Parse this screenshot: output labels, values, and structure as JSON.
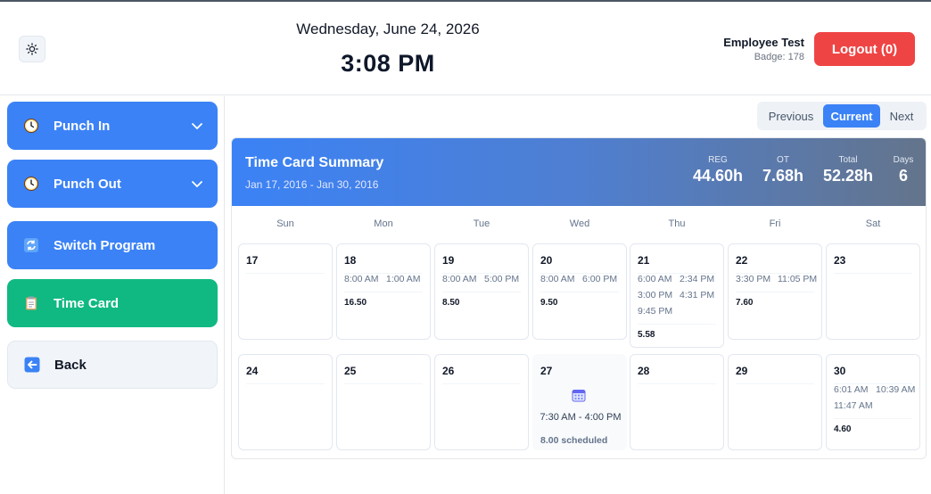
{
  "header": {
    "date": "Wednesday, June 24, 2026",
    "time": "3:08 PM",
    "theme_icon": "sun-icon",
    "employee_name": "Employee Test",
    "badge": "Badge: 178",
    "logout_label": "Logout (0)"
  },
  "sidebar": {
    "items": [
      {
        "label": "Punch In",
        "icon": "clock-icon",
        "color": "#3b82f6"
      },
      {
        "label": "Punch Out",
        "icon": "clock-icon",
        "color": "#3b82f6"
      },
      {
        "label": "Switch Program",
        "icon": "refresh-icon",
        "color": "#3b82f6"
      },
      {
        "label": "Time Card",
        "icon": "clipboard-icon",
        "color": "#10b981"
      },
      {
        "label": "Back",
        "icon": "arrow-left-icon",
        "color": "#f1f5f9"
      }
    ]
  },
  "nav": {
    "previous": "Previous",
    "current": "Current",
    "next": "Next"
  },
  "summary": {
    "title": "Time Card Summary",
    "range": "Jan 17, 2016 - Jan 30, 2016",
    "stats": [
      {
        "label": "REG",
        "value": "44.60h"
      },
      {
        "label": "OT",
        "value": "7.68h"
      },
      {
        "label": "Total",
        "value": "52.28h"
      },
      {
        "label": "Days",
        "value": "6"
      }
    ]
  },
  "calendar": {
    "weekdays": [
      "Sun",
      "Mon",
      "Tue",
      "Wed",
      "Thu",
      "Fri",
      "Sat"
    ],
    "week1": [
      {
        "day": "17",
        "punches": [],
        "hours": ""
      },
      {
        "day": "18",
        "punches": [
          "8:00 AM",
          "1:00 AM"
        ],
        "hours": "16.50"
      },
      {
        "day": "19",
        "punches": [
          "8:00 AM",
          "5:00 PM"
        ],
        "hours": "8.50"
      },
      {
        "day": "20",
        "punches": [
          "8:00 AM",
          "6:00 PM"
        ],
        "hours": "9.50"
      },
      {
        "day": "21",
        "punches": [
          "6:00 AM",
          "2:34 PM",
          "3:00 PM",
          "4:31 PM",
          "9:45 PM"
        ],
        "hours": "5.58"
      },
      {
        "day": "22",
        "punches": [
          "3:30 PM",
          "11:05 PM"
        ],
        "hours": "7.60"
      },
      {
        "day": "23",
        "punches": [],
        "hours": ""
      }
    ],
    "week2": [
      {
        "day": "24",
        "punches": [],
        "hours": ""
      },
      {
        "day": "25",
        "punches": [],
        "hours": ""
      },
      {
        "day": "26",
        "punches": [],
        "hours": ""
      },
      {
        "day": "27",
        "scheduled_time": "7:30 AM - 4:00 PM",
        "scheduled_label": "8.00 scheduled",
        "icon": "calendar-icon"
      },
      {
        "day": "28",
        "punches": [],
        "hours": ""
      },
      {
        "day": "29",
        "punches": [],
        "hours": ""
      },
      {
        "day": "30",
        "punches": [
          "6:01 AM",
          "10:39 AM",
          "11:47 AM"
        ],
        "hours": "4.60"
      }
    ]
  }
}
